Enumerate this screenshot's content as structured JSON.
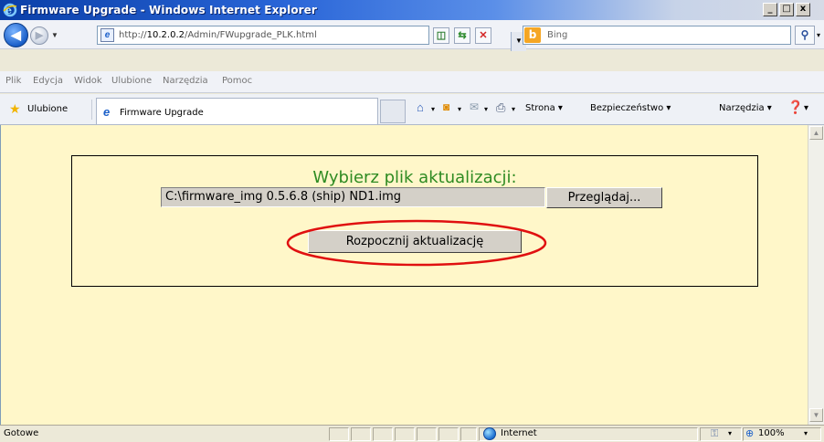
{
  "window": {
    "title": "Firmware Upgrade - Windows Internet Explorer",
    "controls": {
      "minimize": "_",
      "maximize": "□",
      "close": "x"
    }
  },
  "address_bar": {
    "url_prefix": "http://",
    "url_host": "10.2.0.2",
    "url_path": "/Admin/FWupgrade_PLK.html",
    "search_placeholder": "Bing",
    "search_engine_glyph": "b"
  },
  "menu": {
    "items": [
      "Plik",
      "Edycja",
      "Widok",
      "Ulubione",
      "Narzędzia",
      "Pomoc"
    ]
  },
  "favorites_bar": {
    "favorites_label": "Ulubione",
    "tab_title": "Firmware Upgrade",
    "commands": {
      "page": "Strona ▾",
      "safety": "Bezpieczeństwo ▾",
      "tools": "Narzędzia ▾",
      "help": "▾"
    }
  },
  "page": {
    "choose_file_label": "Wybierz plik aktualizacji:",
    "file_value": "C:\\firmware_img 0.5.6.8 (ship) ND1.img",
    "browse_button": "Przeglądaj...",
    "start_button": "Rozpocznij aktualizację",
    "background_color": "#fff7c9",
    "title_color": "#2e8b22",
    "highlight_color": "#e01010"
  },
  "status_bar": {
    "status": "Gotowe",
    "zone": "Internet",
    "zoom": "100%"
  }
}
